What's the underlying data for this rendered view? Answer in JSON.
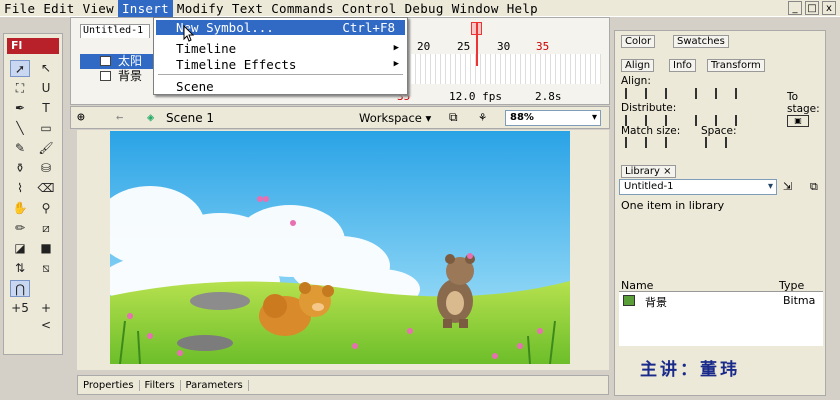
{
  "menubar": [
    "File",
    "Edit",
    "View",
    "Insert",
    "Modify",
    "Text",
    "Commands",
    "Control",
    "Debug",
    "Window",
    "Help"
  ],
  "window_controls": [
    "_",
    "□",
    "x"
  ],
  "tools": {
    "logo": "Fl"
  },
  "document": {
    "tab": "Untitled-1"
  },
  "timeline": {
    "layers": [
      "太阳",
      "背景"
    ],
    "frame_numbers": [
      "20",
      "25",
      "30",
      "35"
    ],
    "current_frame": "35",
    "fps": "12.0 fps",
    "time": "2.8s"
  },
  "editbar": {
    "scene": "Scene 1",
    "workspace": "Workspace",
    "zoom": "88%"
  },
  "insert_menu": {
    "items": [
      {
        "label": "New Symbol...",
        "shortcut": "Ctrl+F8"
      },
      {
        "label": "Timeline"
      },
      {
        "label": "Timeline Effects"
      },
      {
        "label": "Scene"
      }
    ]
  },
  "properties": {
    "tabs": [
      "Properties",
      "Filters",
      "Parameters"
    ]
  },
  "right": {
    "color_tabs": [
      "Color",
      "Swatches"
    ],
    "align_tabs": [
      "Align",
      "Info",
      "Transform"
    ],
    "align_labels": {
      "align": "Align:",
      "distribute": "Distribute:",
      "match": "Match size:",
      "space": "Space:",
      "to": "To",
      "stage": "stage:"
    },
    "library": {
      "tab": "Library",
      "doc": "Untitled-1",
      "count": "One item in library",
      "col_name": "Name",
      "col_type": "Type",
      "item_name": "背景",
      "item_type": "Bitma"
    }
  },
  "overlay": {
    "teacher": "主讲：董玮"
  }
}
